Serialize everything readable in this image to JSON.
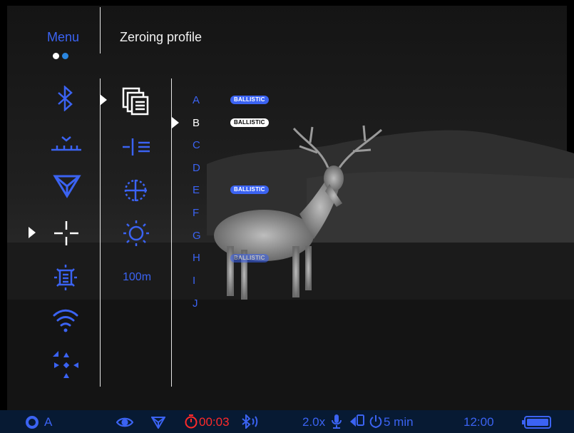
{
  "header": {
    "menu_label": "Menu",
    "page_title": "Zeroing profile"
  },
  "menu_icons": [
    "bluetooth-icon",
    "zeroing-distance-icon",
    "triangle-reticle-icon",
    "crosshair-icon",
    "display-settings-icon",
    "wifi-icon",
    "arrows-center-icon"
  ],
  "selected_menu_item": "crosshair-icon",
  "submenu": {
    "items": [
      "profile-list-icon",
      "reticle-list-icon",
      "zeroing-target-icon",
      "brightness-icon"
    ],
    "distance": "100m"
  },
  "profiles": [
    {
      "letter": "A",
      "badge": "BALLISTIC",
      "badge_style": "blue"
    },
    {
      "letter": "B",
      "badge": "BALLISTIC",
      "badge_style": "white",
      "selected": true
    },
    {
      "letter": "C",
      "badge": ""
    },
    {
      "letter": "D",
      "badge": ""
    },
    {
      "letter": "E",
      "badge": "BALLISTIC",
      "badge_style": "blue"
    },
    {
      "letter": "F",
      "badge": ""
    },
    {
      "letter": "G",
      "badge": ""
    },
    {
      "letter": "H",
      "badge": "BALLISTIC",
      "badge_style": "blue-faded"
    },
    {
      "letter": "I",
      "badge": ""
    },
    {
      "letter": "J",
      "badge": ""
    }
  ],
  "status_bar": {
    "profile": "A",
    "timer": "00:03",
    "zoom": "2.0x",
    "auto_off": "5 min",
    "clock": "12:00",
    "battery_level": 1.0
  },
  "colors": {
    "accent": "#3b63f2",
    "alert": "#ff2a2a",
    "status_bg": "#071a33"
  }
}
